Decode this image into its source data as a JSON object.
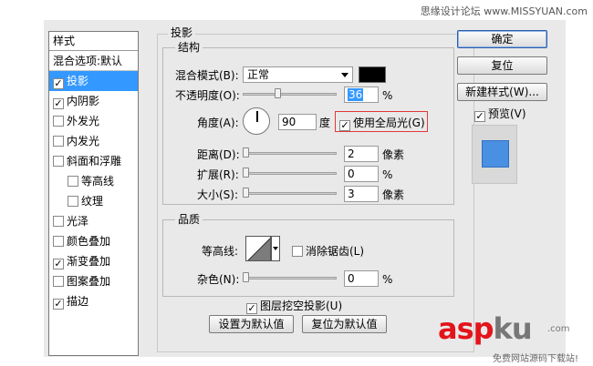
{
  "watermark": {
    "top_text": "思缘设计论坛 www.MISSYUAN.com"
  },
  "style_list": {
    "header": "样式",
    "blend_default": "混合选项:默认",
    "items": [
      {
        "label": "投影",
        "checked": true,
        "selected": true
      },
      {
        "label": "内阴影",
        "checked": true
      },
      {
        "label": "外发光",
        "checked": false
      },
      {
        "label": "内发光",
        "checked": false
      },
      {
        "label": "斜面和浮雕",
        "checked": false
      },
      {
        "label": "等高线",
        "checked": false,
        "indent": true
      },
      {
        "label": "纹理",
        "checked": false,
        "indent": true
      },
      {
        "label": "光泽",
        "checked": false
      },
      {
        "label": "颜色叠加",
        "checked": false
      },
      {
        "label": "渐变叠加",
        "checked": true
      },
      {
        "label": "图案叠加",
        "checked": false
      },
      {
        "label": "描边",
        "checked": true
      }
    ]
  },
  "shadow": {
    "title": "投影",
    "structure_title": "结构",
    "blend_mode_label": "混合模式(B):",
    "blend_mode_value": "正常",
    "opacity_label": "不透明度(O):",
    "opacity_value": "36",
    "opacity_unit": "%",
    "angle_label": "角度(A):",
    "angle_value": "90",
    "angle_unit": "度",
    "global_light_label": "使用全局光(G)",
    "global_light_checked": true,
    "distance_label": "距离(D):",
    "distance_value": "2",
    "distance_unit": "像素",
    "spread_label": "扩展(R):",
    "spread_value": "0",
    "spread_unit": "%",
    "size_label": "大小(S):",
    "size_value": "3",
    "size_unit": "像素",
    "quality_title": "品质",
    "contour_label": "等高线:",
    "anti_alias_label": "消除锯齿(L)",
    "anti_alias_checked": false,
    "noise_label": "杂色(N):",
    "noise_value": "0",
    "noise_unit": "%",
    "knockout_label": "图层挖空投影(U)",
    "knockout_checked": true,
    "set_default_btn": "设置为默认值",
    "reset_default_btn": "复位为默认值"
  },
  "right_panel": {
    "ok_btn": "确定",
    "reset_btn": "复位",
    "new_style_btn": "新建样式(W)...",
    "preview_label": "预览(V)",
    "preview_checked": true
  },
  "aspku": {
    "logo_red": "asp",
    "logo_gray": "ku",
    "dotcom": ".com",
    "subtitle": "免费网站源码下载站!"
  },
  "colors": {
    "selection": "#3398ff",
    "highlight_border": "#e03a3a",
    "logo_red": "#e3141b"
  }
}
